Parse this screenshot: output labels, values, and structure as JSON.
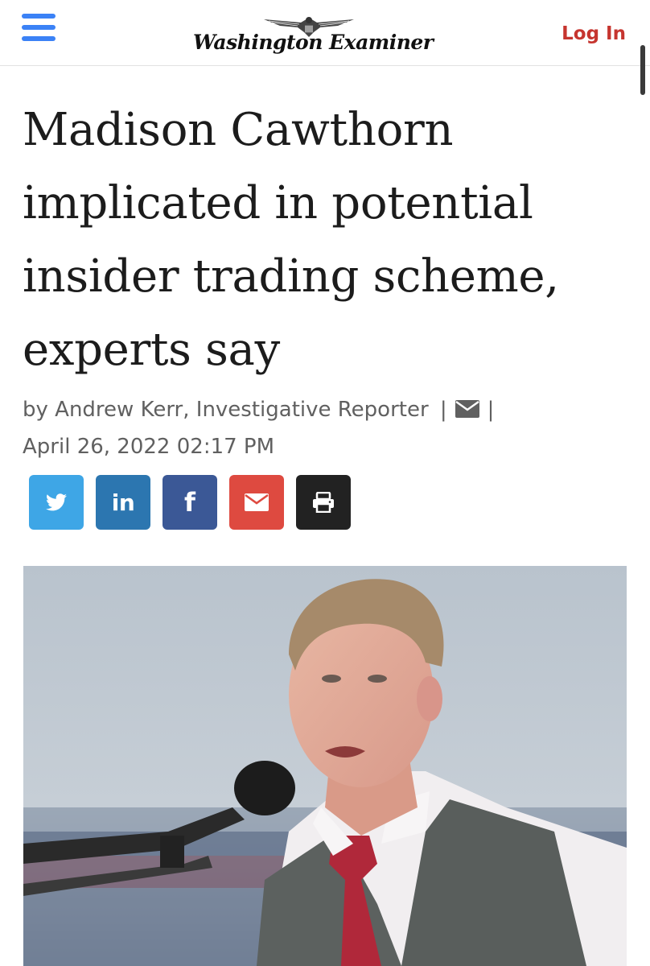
{
  "header": {
    "menu_icon": "hamburger-menu-icon",
    "logo_text": "Washington Examiner",
    "logo_icon": "eagle-seal-icon",
    "login_label": "Log In",
    "accent_color": "#3b82f6",
    "login_color": "#c6352f"
  },
  "article": {
    "headline": "Madison Cawthorn implicated in potential insider trading scheme, experts say",
    "byline_author": "by Andrew Kerr, Investigative Reporter",
    "byline_separator": "|",
    "byline_mail_icon": "envelope-icon",
    "date": "April 26, 2022 02:17 PM"
  },
  "share": {
    "buttons": [
      {
        "icon": "twitter-icon",
        "color": "#3ea6e6"
      },
      {
        "icon": "linkedin-icon",
        "label": "in",
        "color": "#2c76b0"
      },
      {
        "icon": "facebook-icon",
        "label": "f",
        "color": "#3b5896"
      },
      {
        "icon": "email-icon",
        "color": "#de4a40"
      },
      {
        "icon": "print-icon",
        "color": "#222222"
      }
    ]
  },
  "media": {
    "photo_icon": "article-photo"
  }
}
